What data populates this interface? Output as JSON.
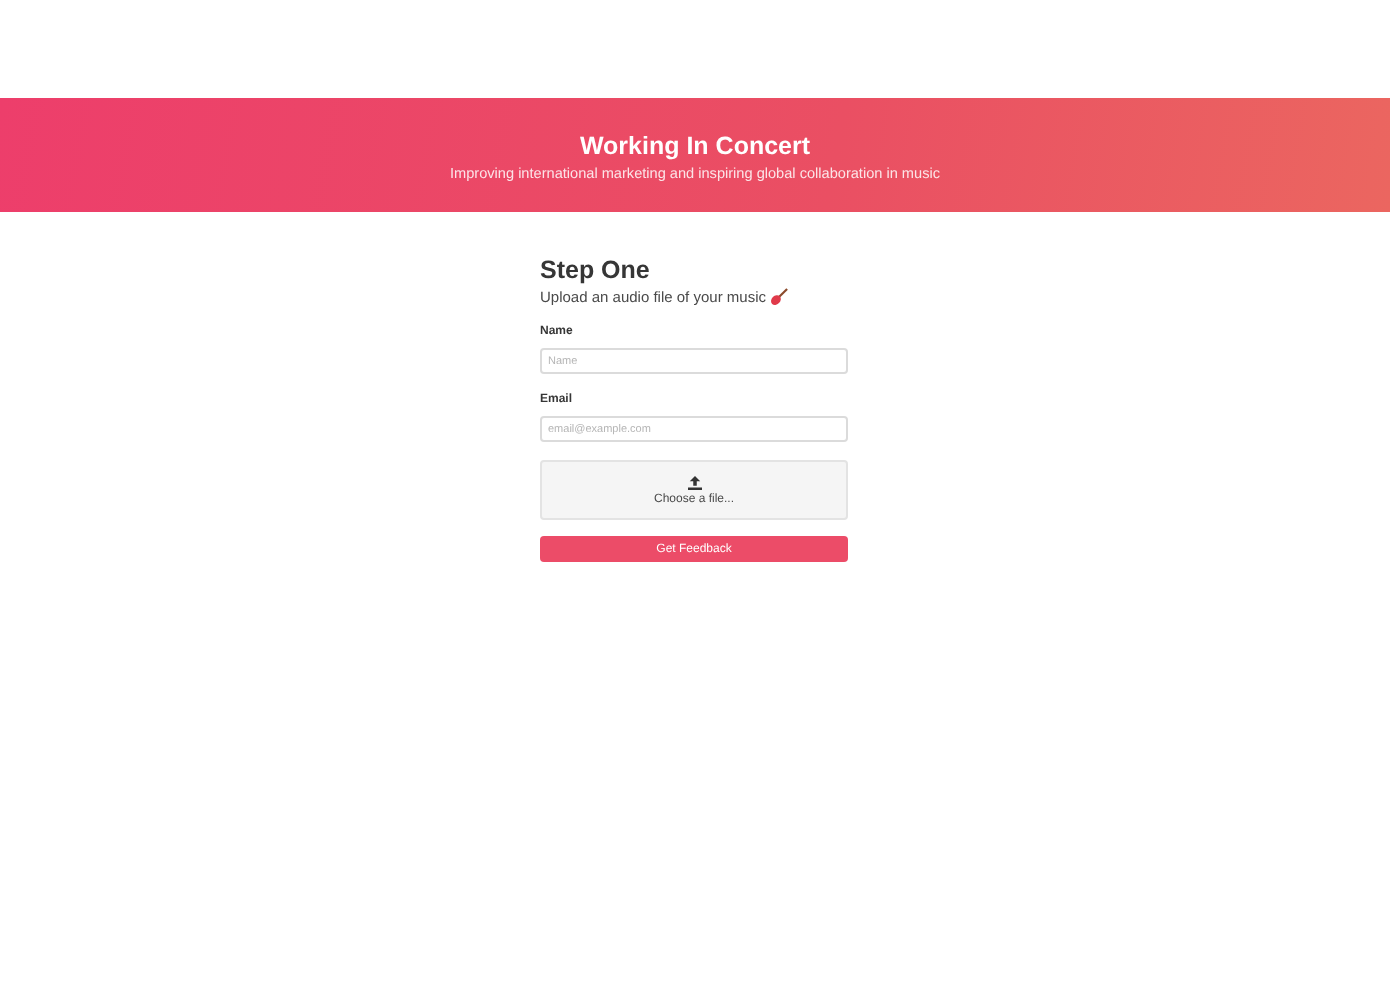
{
  "header": {
    "title": "Working In Concert",
    "subtitle": "Improving international marketing and inspiring global collaboration in music"
  },
  "form": {
    "heading": "Step One",
    "intro": "Upload an audio file of your music",
    "fields": [
      {
        "label": "Name",
        "placeholder": "Name"
      },
      {
        "label": "Email",
        "placeholder": "email@example.com"
      }
    ],
    "upload": {
      "label": "Choose a file..."
    },
    "submit": "Get Feedback"
  }
}
